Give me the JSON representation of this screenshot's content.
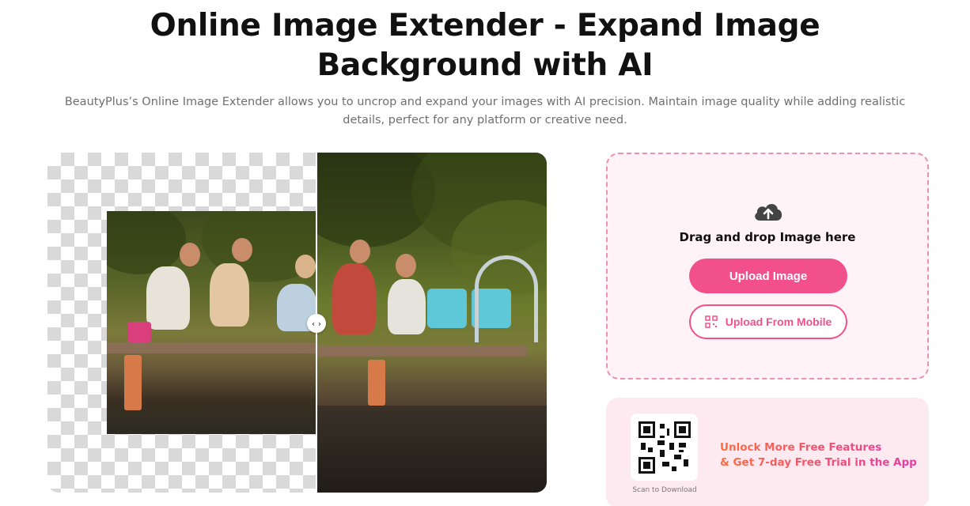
{
  "header": {
    "title": "Online Image Extender - Expand Image Background with AI",
    "subtitle": "BeautyPlus’s Online Image Extender allows you to uncrop and expand your images with AI precision. Maintain image quality while adding realistic details, perfect for any platform or creative need."
  },
  "compare": {
    "handle_glyph": "‹ ›"
  },
  "upload": {
    "drag_text": "Drag and drop Image here",
    "upload_button": "Upload Image",
    "mobile_button": "Upload From Mobile"
  },
  "promo": {
    "line1": "Unlock More Free Features",
    "line2": "& Get 7-day Free Trial in the App",
    "scan_label": "Scan to Download"
  },
  "colors": {
    "accent": "#f2508a",
    "upload_bg": "#fff3f7",
    "promo_bg": "#fde9f0"
  },
  "icons": [
    "upload-cloud-icon",
    "qr-code-icon",
    "compare-arrows-icon"
  ]
}
